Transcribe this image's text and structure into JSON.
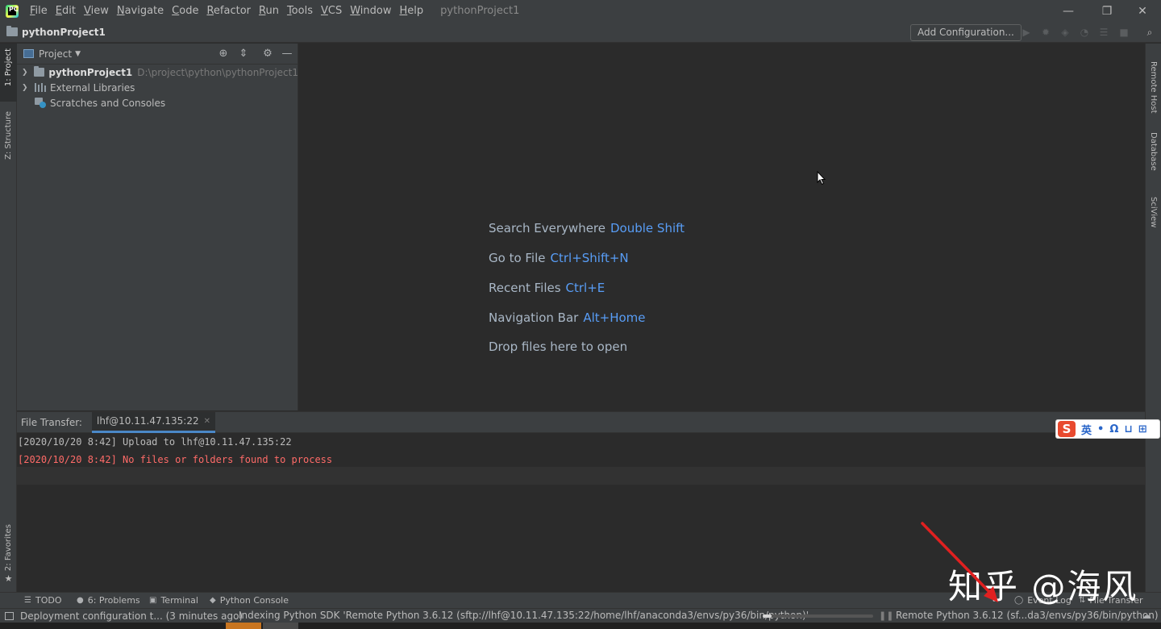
{
  "menubar": {
    "items": [
      "File",
      "Edit",
      "View",
      "Navigate",
      "Code",
      "Refactor",
      "Run",
      "Tools",
      "VCS",
      "Window",
      "Help"
    ],
    "window_title": "pythonProject1"
  },
  "navbar": {
    "breadcrumb": "pythonProject1",
    "add_config": "Add Configuration..."
  },
  "left_strip": {
    "project_tab": "1: Project",
    "structure_tab": "Z: Structure",
    "favorites_tab": "2: Favorites"
  },
  "right_strip": {
    "remote_host": "Remote Host",
    "database": "Database",
    "sciview": "SciView"
  },
  "project_panel": {
    "view_label": "Project",
    "tree": [
      {
        "label": "pythonProject1",
        "path": "D:\\project\\python\\pythonProject1"
      },
      {
        "label": "External Libraries"
      },
      {
        "label": "Scratches and Consoles"
      }
    ]
  },
  "editor": {
    "hints": [
      {
        "text": "Search Everywhere",
        "shortcut": "Double Shift"
      },
      {
        "text": "Go to File",
        "shortcut": "Ctrl+Shift+N"
      },
      {
        "text": "Recent Files",
        "shortcut": "Ctrl+E"
      },
      {
        "text": "Navigation Bar",
        "shortcut": "Alt+Home"
      },
      {
        "text": "Drop files here to open",
        "shortcut": ""
      }
    ]
  },
  "file_transfer": {
    "title": "File Transfer:",
    "tab": "lhf@10.11.47.135:22",
    "log": [
      "[2020/10/20 8:42] Upload to lhf@10.11.47.135:22",
      "[2020/10/20 8:42] No files or folders found to process"
    ]
  },
  "ime": {
    "logo": "S",
    "items": [
      "英",
      "•",
      "Ω",
      "⊔",
      "⊞"
    ]
  },
  "tool_strip": {
    "todo": "TODO",
    "problems": "6: Problems",
    "terminal": "Terminal",
    "python_console": "Python Console",
    "event_log": "Event Log",
    "file_transfer": "File Transfer"
  },
  "status_bar": {
    "message": "Deployment configuration t... (3 minutes ago)",
    "indexing": "Indexing Python SDK 'Remote Python 3.6.12 (sftp://lhf@10.11.47.135:22/home/lhf/anaconda3/envs/py36/bin/python)'",
    "progress": 0.08,
    "interpreter": "Remote Python 3.6.12 (sf...da3/envs/py36/bin/python)"
  },
  "watermark": "知乎 @海风",
  "colors": {
    "accent": "#589df6",
    "error": "#ff6b68",
    "arrow": "#e02020"
  }
}
